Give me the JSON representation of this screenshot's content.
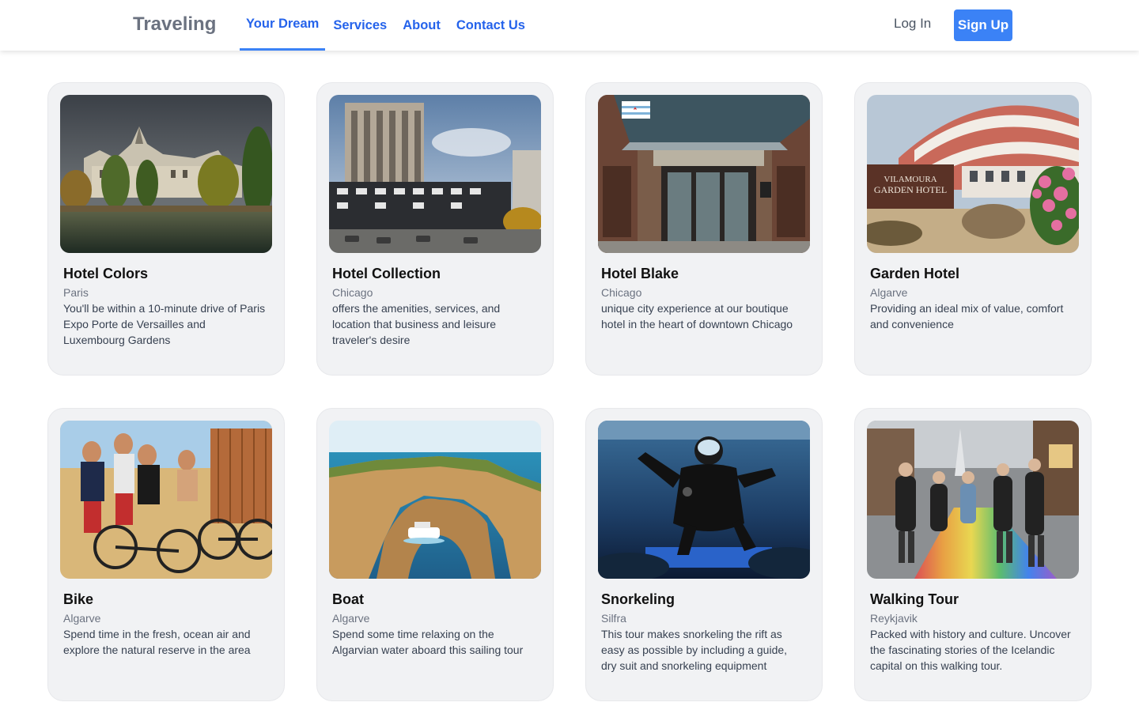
{
  "header": {
    "brand": "Traveling",
    "nav": [
      "Your Dream",
      "Services",
      "About",
      "Contact Us"
    ],
    "login": "Log In",
    "signup": "Sign Up"
  },
  "cards": [
    {
      "title": "Hotel Colors",
      "location": "Paris",
      "description": "You'll be within a 10-minute drive of Paris Expo Porte de Versailles and Luxembourg Gardens"
    },
    {
      "title": "Hotel Collection",
      "location": "Chicago",
      "description": "offers the amenities, services, and location that business and leisure traveler's desire"
    },
    {
      "title": "Hotel Blake",
      "location": "Chicago",
      "description": "unique city experience at our boutique hotel in the heart of downtown Chicago"
    },
    {
      "title": "Garden Hotel",
      "location": "Algarve",
      "description": "Providing an ideal mix of value, comfort and convenience",
      "sign": [
        "VILAMOURA",
        "GARDEN HOTEL"
      ]
    },
    {
      "title": "Bike",
      "location": "Algarve",
      "description": "Spend time in the fresh, ocean air and explore the natural reserve in the area"
    },
    {
      "title": "Boat",
      "location": "Algarve",
      "description": "Spend some time relaxing on the Algarvian water aboard this sailing tour"
    },
    {
      "title": "Snorkeling",
      "location": "Silfra",
      "description": "This tour makes snorkeling the rift as easy as possible by including a guide, dry suit and snorkeling equipment"
    },
    {
      "title": "Walking Tour",
      "location": "Reykjavik",
      "description": "Packed with history and culture. Uncover the fascinating stories of the Icelandic capital on this walking tour."
    }
  ]
}
